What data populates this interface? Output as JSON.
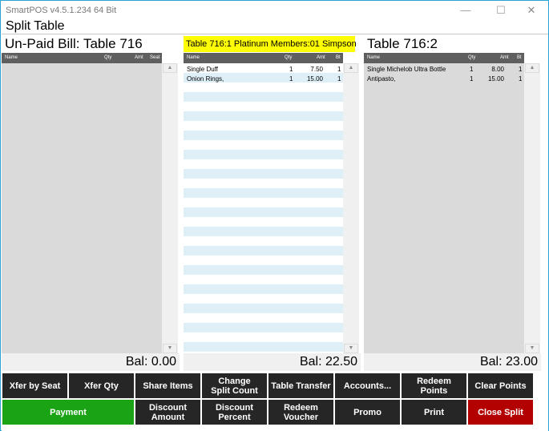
{
  "window": {
    "title": "SmartPOS v4.5.1.234 64 Bit"
  },
  "header": {
    "title": "Split Table"
  },
  "columns": {
    "name": "Name",
    "qty": "Qty",
    "amt": "Amt",
    "seat": "Seat",
    "bt": "Bt"
  },
  "left_panel": {
    "title": "Un-Paid Bill: Table 716",
    "balance": "Bal: 0.00",
    "rows": []
  },
  "middle_panel": {
    "title": "Table 716:1 Platinum  Members:01 Simpson",
    "balance": "Bal: 22.50",
    "rows": [
      {
        "name": "Single Duff",
        "qty": "1",
        "amt": "7.50",
        "bt": "1"
      },
      {
        "name": "Onion Rings,",
        "qty": "1",
        "amt": "15.00",
        "bt": "1"
      }
    ]
  },
  "right_panel": {
    "title": "Table 716:2",
    "balance": "Bal: 23.00",
    "rows": [
      {
        "name": "Single Michelob Ultra Bottle",
        "qty": "1",
        "amt": "8.00",
        "bt": "1"
      },
      {
        "name": "Antipasto,",
        "qty": "1",
        "amt": "15.00",
        "bt": "1"
      }
    ]
  },
  "buttons": {
    "row1": [
      {
        "id": "xfer-by-seat",
        "label": "Xfer by Seat"
      },
      {
        "id": "xfer-qty",
        "label": "Xfer Qty"
      },
      {
        "id": "share-items",
        "label": "Share Items"
      },
      {
        "id": "change-split-count",
        "label": "Change\nSplit Count"
      },
      {
        "id": "table-transfer",
        "label": "Table Transfer"
      },
      {
        "id": "accounts",
        "label": "Accounts..."
      },
      {
        "id": "redeem-points",
        "label": "Redeem\nPoints"
      },
      {
        "id": "clear-points",
        "label": "Clear Points"
      }
    ],
    "row2": [
      {
        "id": "payment",
        "label": "Payment"
      },
      {
        "id": "discount-amount",
        "label": "Discount\nAmount"
      },
      {
        "id": "discount-percent",
        "label": "Discount\nPercent"
      },
      {
        "id": "redeem-voucher",
        "label": "Redeem\nVoucher"
      },
      {
        "id": "promo",
        "label": "Promo"
      },
      {
        "id": "print",
        "label": "Print"
      },
      {
        "id": "close-split",
        "label": "Close Split"
      }
    ]
  },
  "colors": {
    "accent_green": "#1aa314",
    "accent_red": "#b30000",
    "member_highlight": "#ffff00",
    "row_stripe": "#deeff7"
  }
}
